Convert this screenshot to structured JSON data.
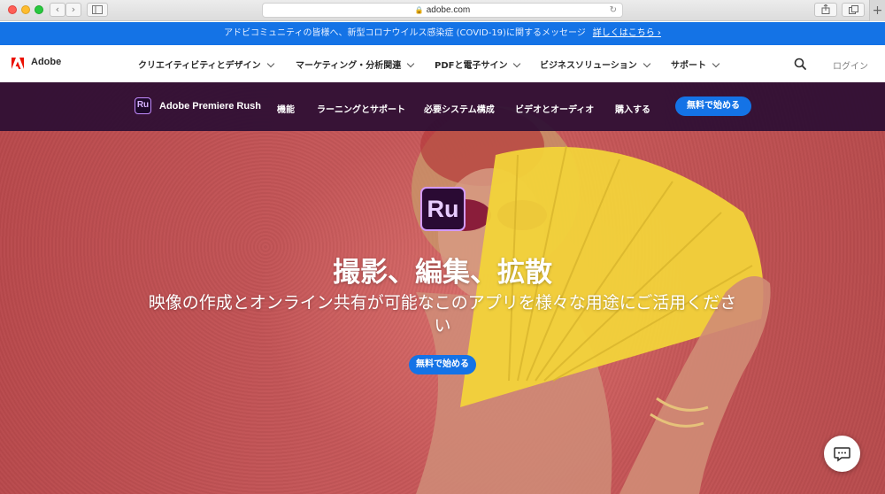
{
  "browser": {
    "url": "adobe.com",
    "back_glyph": "‹",
    "forward_glyph": "›",
    "new_tab_glyph": "+"
  },
  "notice": {
    "text": "アドビコミュニティの皆様へ、新型コロナウイルス感染症 (COVID-19)に関するメッセージ",
    "link": "詳しくはこちら ›"
  },
  "global_nav": {
    "brand": "Adobe",
    "items": [
      {
        "label": "クリエイティビティとデザイン"
      },
      {
        "label": "マーケティング・分析関連"
      },
      {
        "label": "PDFと電子サイン"
      },
      {
        "label": "ビジネスソリューション"
      },
      {
        "label": "サポート"
      }
    ],
    "login": "ログイン"
  },
  "product_nav": {
    "icon_text": "Ru",
    "product_name": "Adobe Premiere Rush",
    "items": [
      {
        "label": "機能"
      },
      {
        "label": "ラーニングとサポート"
      },
      {
        "label": "必要システム構成"
      },
      {
        "label": "ビデオとオーディオ"
      },
      {
        "label": "購入する"
      }
    ],
    "cta": "無料で始める"
  },
  "hero": {
    "icon_text": "Ru",
    "title": "撮影、編集、拡散",
    "subtitle": "映像の作成とオンライン共有が可能なこのアプリを様々な用途にご活用ください",
    "cta": "無料で始める"
  },
  "colors": {
    "accent": "#1473e6",
    "subnav_bg": "#2c0e34",
    "hero_bg": "#c45658",
    "fan": "#f2d33a"
  }
}
